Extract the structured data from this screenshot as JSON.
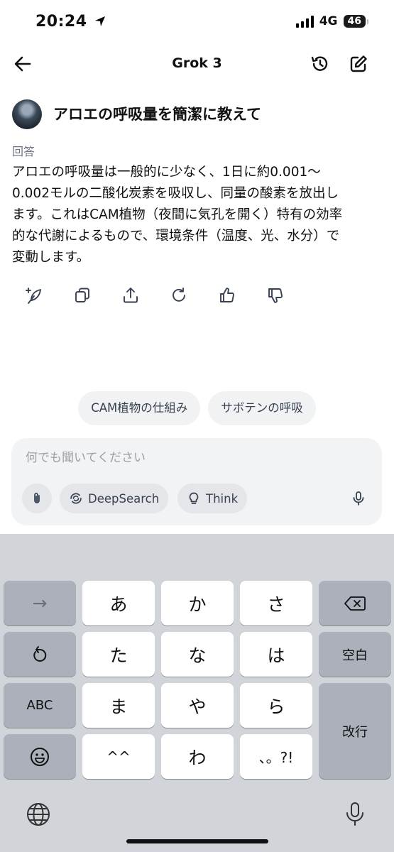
{
  "status_bar": {
    "time": "20:24",
    "network": "4G",
    "battery": "46"
  },
  "header": {
    "title": "Grok 3"
  },
  "conversation": {
    "question": "アロエの呼吸量を簡潔に教えて",
    "answer_label": "回答",
    "answer_lines": [
      "アロエの呼吸量は一般的に少なく、1日に約0.001〜",
      "0.002モルの二酸化炭素を吸収し、同量の酸素を放出し",
      "ます。これはCAM植物（夜間に気孔を開く）特有の効率",
      "的な代謝によるもので、環境条件（温度、光、水分）で",
      "変動します。"
    ]
  },
  "suggestions": [
    "CAM植物の仕組み",
    "サボテンの呼吸"
  ],
  "composer": {
    "placeholder": "何でも聞いてください",
    "deepsearch_label": "DeepSearch",
    "think_label": "Think"
  },
  "keyboard": {
    "row1": {
      "arrow": "→",
      "k1": "あ",
      "k2": "か",
      "k3": "さ"
    },
    "row2": {
      "k1": "た",
      "k2": "な",
      "k3": "は",
      "space": "空白"
    },
    "row3": {
      "abc": "ABC",
      "k1": "ま",
      "k2": "や",
      "k3": "ら",
      "enter": "改行"
    },
    "row4": {
      "k1": "^^",
      "k2": "わ",
      "k3": "、。?!"
    }
  },
  "colors": {
    "keyboard_bg": "#d1d4d9",
    "chip_bg": "#f0f2f4",
    "composer_bg": "#f2f3f5"
  }
}
